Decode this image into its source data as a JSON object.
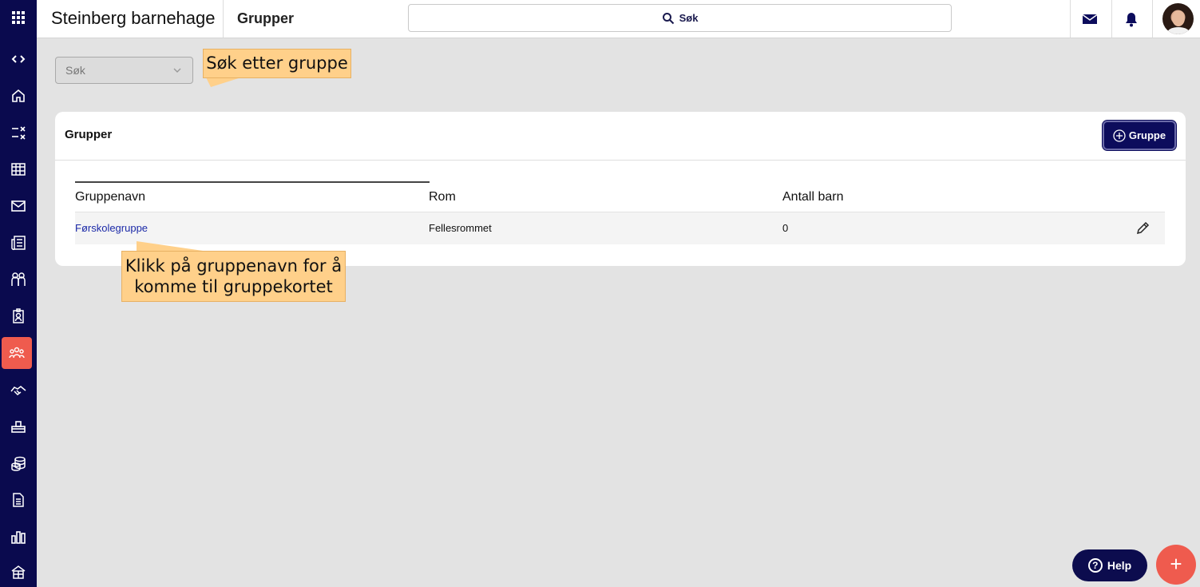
{
  "app": {
    "title": "Steinberg barnehage",
    "page_title": "Grupper"
  },
  "topbar": {
    "search_label": "Søk"
  },
  "filter": {
    "placeholder": "Søk"
  },
  "callouts": {
    "search_hint": "Søk etter gruppe",
    "link_hint": "Klikk på gruppenavn for å komme til gruppekortet"
  },
  "card": {
    "title": "Grupper",
    "add_button": "Gruppe",
    "columns": [
      "Gruppenavn",
      "Rom",
      "Antall barn"
    ],
    "rows": [
      {
        "name": "Førskolegruppe",
        "room": "Fellesrommet",
        "children": "0"
      }
    ]
  },
  "help": {
    "label": "Help",
    "q": "?"
  },
  "fab": {
    "label": "+"
  },
  "colors": {
    "sidebar": "#0a0a4e",
    "accent": "#ef5b4e",
    "primary_button": "#0c0c5c",
    "callout": "#ffd08a",
    "link": "#1c2aa8"
  },
  "sidebar_icons": [
    "apps-grid-icon",
    "collapse-expand-icon",
    "home-icon",
    "checklist-icon",
    "calendar-icon",
    "mail-icon",
    "news-icon",
    "people-icon",
    "badge-icon",
    "groups-icon",
    "handshake-icon",
    "bed-icon",
    "coins-icon",
    "document-icon",
    "report-chart-icon",
    "building-icon"
  ]
}
